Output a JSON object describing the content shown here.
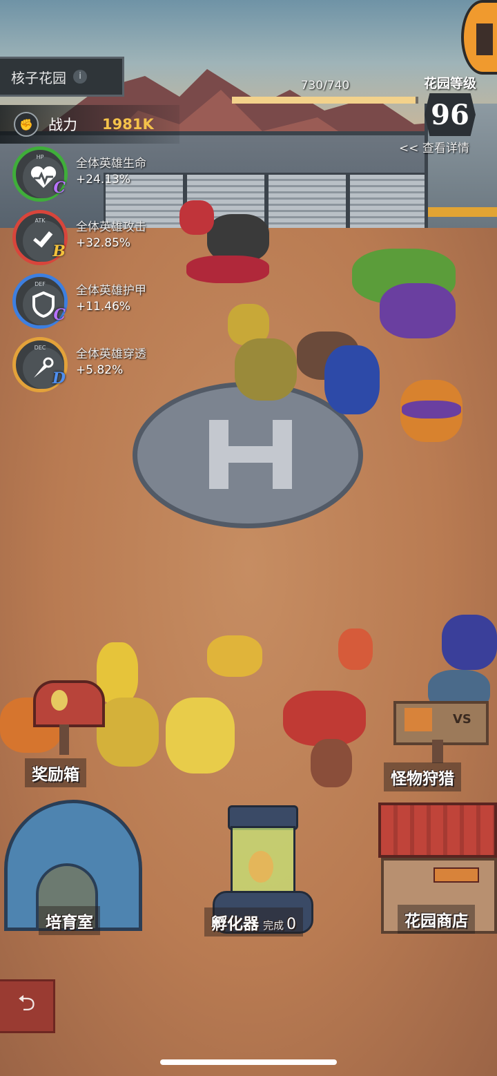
{
  "garden": {
    "name": "核子花园",
    "info_icon": "i"
  },
  "power": {
    "label": "战力",
    "value": "1981K"
  },
  "stats": [
    {
      "abbr": "HP",
      "name": "全体英雄生命",
      "value": "+24.13%",
      "grade": "C",
      "ring_color": "#3fae3a",
      "grade_color": "#b873ff"
    },
    {
      "abbr": "ATK",
      "name": "全体英雄攻击",
      "value": "+32.85%",
      "grade": "B",
      "ring_color": "#d8453b",
      "grade_color": "#f3c23c"
    },
    {
      "abbr": "DEF",
      "name": "全体英雄护甲",
      "value": "+11.46%",
      "grade": "C",
      "ring_color": "#3d7fe0",
      "grade_color": "#b873ff"
    },
    {
      "abbr": "DEC",
      "name": "全体英雄穿透",
      "value": "+5.82%",
      "grade": "D",
      "ring_color": "#e3a23a",
      "grade_color": "#4f8ff0"
    }
  ],
  "progress": {
    "text": "730/740",
    "fraction": 0.986
  },
  "level": {
    "title": "花园等级",
    "number": "96"
  },
  "detail": {
    "label": "<< 查看详情"
  },
  "facilities": {
    "reward_box": "奖励箱",
    "monster_hunt": "怪物狩猎",
    "breeding_room": "培育室",
    "incubator": "孵化器",
    "incubator_done_label": "完成",
    "incubator_done_count": "0",
    "garden_shop": "花园商店"
  },
  "signs": {
    "vs": "VS"
  },
  "icons": {
    "back": "back-arrow-icon",
    "fist": "fist-icon"
  }
}
